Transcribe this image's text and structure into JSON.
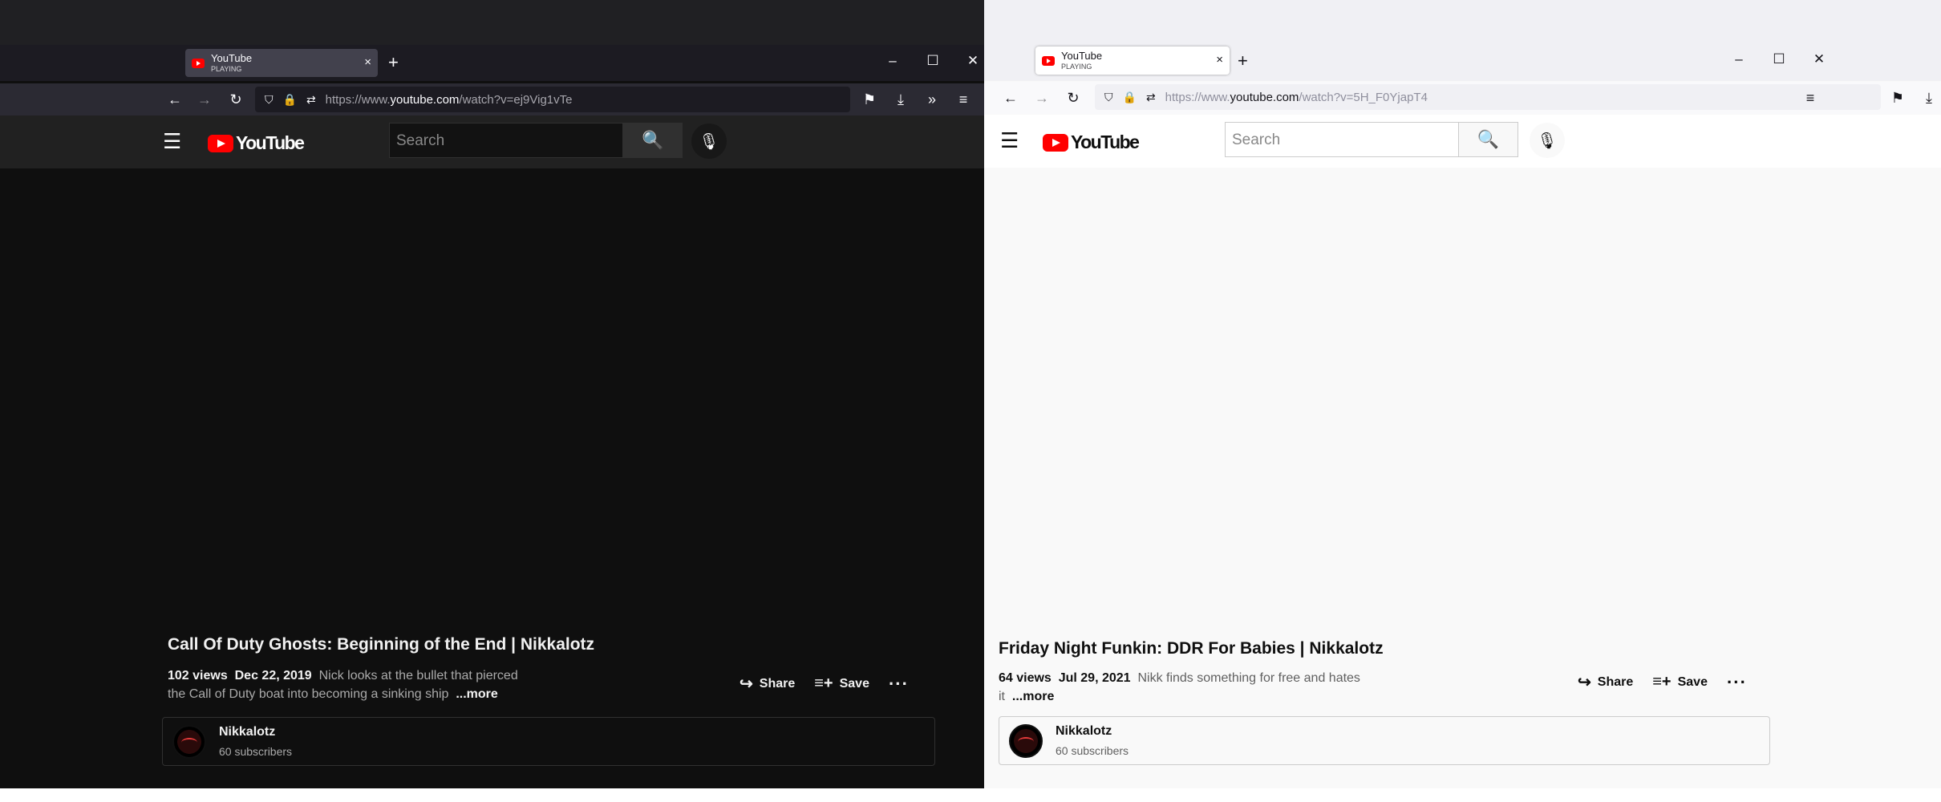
{
  "windows": [
    {
      "tab": {
        "title": "YouTube",
        "subtitle": "PLAYING",
        "close": "×"
      },
      "new_tab": "+",
      "window_controls": {
        "minimize": "–",
        "maximize": "☐",
        "close": "✕"
      },
      "nav": {
        "back": "←",
        "forward": "→",
        "reload": "↻",
        "shield": "⛉",
        "lock": "🔒",
        "permissions": "⇄",
        "pocket": "⚑",
        "download": "⤓",
        "extensions": "»",
        "menu": "≡"
      },
      "url": {
        "prefix": "https://www.",
        "domain": "youtube.com",
        "path": "/watch?v=ej9Vig1vTe"
      },
      "yt": {
        "menu": "☰",
        "logo": "YouTube",
        "search_placeholder": "Search",
        "search_icon": "🔍",
        "mic_icon": "🎙"
      },
      "video": {
        "title": "Call Of Duty Ghosts: Beginning of the End | Nikkalotz",
        "views": "102 views",
        "date": "Dec 22, 2019",
        "description": "Nick looks at the bullet that pierced the Call of Duty boat into becoming a sinking ship",
        "more": "...more"
      },
      "actions": {
        "share": "Share",
        "share_icon": "↪",
        "save": "Save",
        "save_icon": "≡+",
        "more": "···"
      },
      "channel": {
        "name": "Nikkalotz",
        "subscribers": "60 subscribers"
      }
    },
    {
      "tab": {
        "title": "YouTube",
        "subtitle": "PLAYING",
        "close": "×"
      },
      "new_tab": "+",
      "window_controls": {
        "minimize": "–",
        "maximize": "☐",
        "close": "✕"
      },
      "nav": {
        "back": "←",
        "forward": "→",
        "reload": "↻",
        "shield": "⛉",
        "lock": "🔒",
        "permissions": "⇄",
        "pocket": "⚑",
        "download": "⤓",
        "extensions": "»",
        "menu": "≡"
      },
      "url": {
        "prefix": "https://www.",
        "domain": "youtube.com",
        "path": "/watch?v=5H_F0YjapT4"
      },
      "yt": {
        "menu": "☰",
        "logo": "YouTube",
        "search_placeholder": "Search",
        "search_icon": "🔍",
        "mic_icon": "🎙"
      },
      "video": {
        "title": "Friday Night Funkin: DDR For Babies | Nikkalotz",
        "views": "64 views",
        "date": "Jul 29, 2021",
        "description": "Nikk finds something for free and hates it",
        "more": "...more"
      },
      "actions": {
        "share": "Share",
        "share_icon": "↪",
        "save": "Save",
        "save_icon": "≡+",
        "more": "···"
      },
      "channel": {
        "name": "Nikkalotz",
        "subscribers": "60 subscribers"
      }
    }
  ],
  "colors": {
    "youtube_red": "#ff0000",
    "dark_bg": "#0f0f0f",
    "light_bg": "#f9f9f9"
  }
}
